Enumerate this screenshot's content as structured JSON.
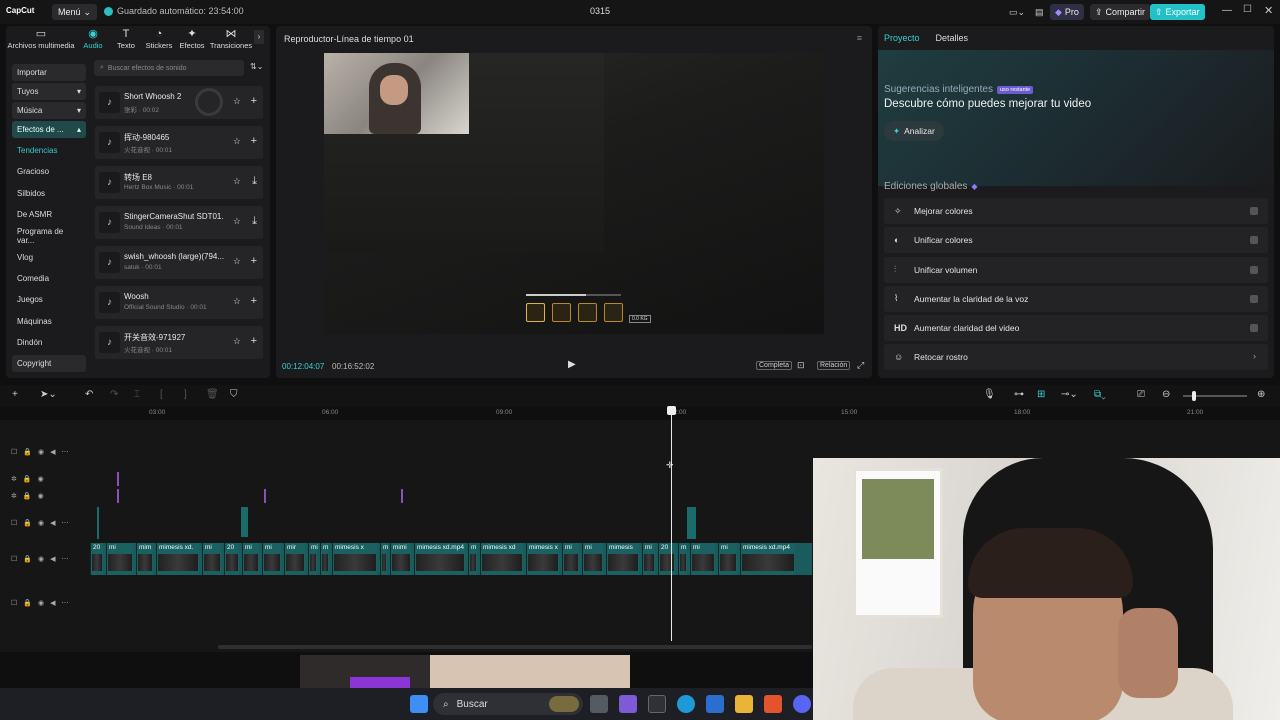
{
  "titlebar": {
    "logo": "CapCut",
    "menu": "Menú",
    "autosave": "Guardado automático: 23:54:00",
    "project": "0315",
    "pro": "Pro",
    "share": "Compartir",
    "export": "Exportar"
  },
  "categories": [
    {
      "label": "Archivos multimedia",
      "icon": "▭"
    },
    {
      "label": "Audio",
      "icon": "◉"
    },
    {
      "label": "Texto",
      "icon": "T"
    },
    {
      "label": "Stickers",
      "icon": "◔"
    },
    {
      "label": "Efectos",
      "icon": "✦"
    },
    {
      "label": "Transiciones",
      "icon": "⋈"
    }
  ],
  "sidebar": {
    "import": "Importar",
    "yours": "Tuyos",
    "music": "Música",
    "effects": "Efectos de ...",
    "items": [
      "Tendencias",
      "Gracioso",
      "Silbidos",
      "De ASMR",
      "Programa de var...",
      "Vlog",
      "Comedia",
      "Juegos",
      "Máquinas",
      "Dindón"
    ],
    "copyright": "Copyright"
  },
  "search": {
    "placeholder": "Buscar efectos de sonido"
  },
  "sounds": [
    {
      "name": "Short Whoosh 2",
      "meta": "张彩 · 00:02",
      "action": "+"
    },
    {
      "name": "挥动-980465",
      "meta": "火花音视 · 00:01",
      "action": "+"
    },
    {
      "name": "转场 E8",
      "meta": "Hertz Box Music · 00:01",
      "action": "⤓"
    },
    {
      "name": "StingerCameraShut SDT01...",
      "meta": "Sound Ideas · 00:01",
      "action": "⤓"
    },
    {
      "name": "swish_whoosh (large)(794...",
      "meta": "satuk · 00:01",
      "action": "+"
    },
    {
      "name": "Woosh",
      "meta": "Official Sound Studio · 00:01",
      "action": "+"
    },
    {
      "name": "开关音效-971927",
      "meta": "火花音视 · 00:01",
      "action": "+"
    }
  ],
  "player": {
    "title": "Reproductor-Línea de tiempo 01",
    "current": "00:12:04:07",
    "total": "00:16:52:02",
    "full": "Completa",
    "ratio": "Relación",
    "hud_tag": "0.0 KG"
  },
  "right": {
    "tabs": [
      "Proyecto",
      "Detalles"
    ],
    "suggest_title": "Sugerencias inteligentes",
    "suggest_badge": "uso restante",
    "suggest_head": "Descubre cómo puedes mejorar tu video",
    "analyze": "Analizar",
    "global_title": "Ediciones globales",
    "global_items": [
      {
        "label": "Mejorar colores",
        "icon": "✧"
      },
      {
        "label": "Unificar colores",
        "icon": "◐"
      },
      {
        "label": "Unificar volumen",
        "icon": "⫶"
      },
      {
        "label": "Aumentar la claridad de la voz",
        "icon": "⌇"
      },
      {
        "label": "Aumentar claridad del video",
        "icon": "HD"
      },
      {
        "label": "Retocar rostro",
        "icon": "☺"
      }
    ]
  },
  "ruler": [
    "03:00",
    "06:00",
    "09:00",
    "12:00",
    "15:00",
    "18:00",
    "21:00"
  ],
  "clips": [
    "20",
    "mi",
    "mim",
    "mimesis xd.",
    "mi",
    "20",
    "mi",
    "mi",
    "mir",
    "mi",
    "m",
    "mimesis x",
    "m",
    "mimi",
    "mimesis xd.mp4",
    "m",
    "mimesis xd",
    "mimesis x",
    "mi",
    "mi",
    "mimesis",
    "mi",
    "20",
    "m",
    "mi",
    "mi",
    "mimesis xd.mp4"
  ],
  "taskbar": {
    "search": "Buscar"
  }
}
